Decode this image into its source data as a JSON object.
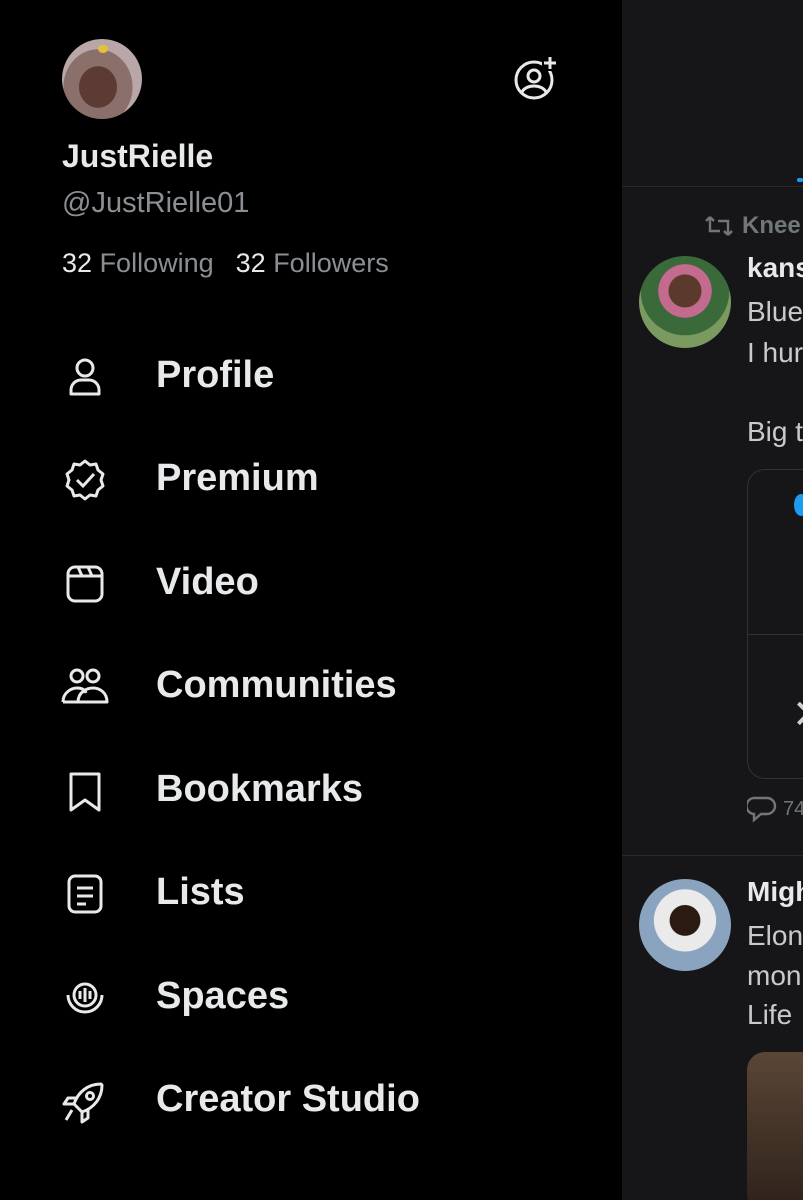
{
  "profile": {
    "display_name": "JustRielle",
    "handle": "@JustRielle01",
    "following_count": "32",
    "following_label": "Following",
    "followers_count": "32",
    "followers_label": "Followers"
  },
  "menu": [
    {
      "label": "Profile",
      "icon": "person-icon"
    },
    {
      "label": "Premium",
      "icon": "verified-badge-icon"
    },
    {
      "label": "Video",
      "icon": "video-icon"
    },
    {
      "label": "Communities",
      "icon": "communities-icon"
    },
    {
      "label": "Bookmarks",
      "icon": "bookmark-icon"
    },
    {
      "label": "Lists",
      "icon": "list-icon"
    },
    {
      "label": "Spaces",
      "icon": "spaces-icon"
    },
    {
      "label": "Creator Studio",
      "icon": "rocket-icon"
    }
  ],
  "feed": {
    "retweet_text": "Knee",
    "post1_name": "kans",
    "post1_line1": "Blue",
    "post1_line2": "I hur",
    "post1_line3": "Big t",
    "reply_count": "74",
    "post2_name": "Migh",
    "post2_line1": "Elon",
    "post2_line2": "mon",
    "post2_line3": "Life"
  },
  "colors": {
    "background": "#000000",
    "text": "#e7e9ea",
    "muted": "#8b8f94",
    "accent": "#1d9bf0"
  }
}
